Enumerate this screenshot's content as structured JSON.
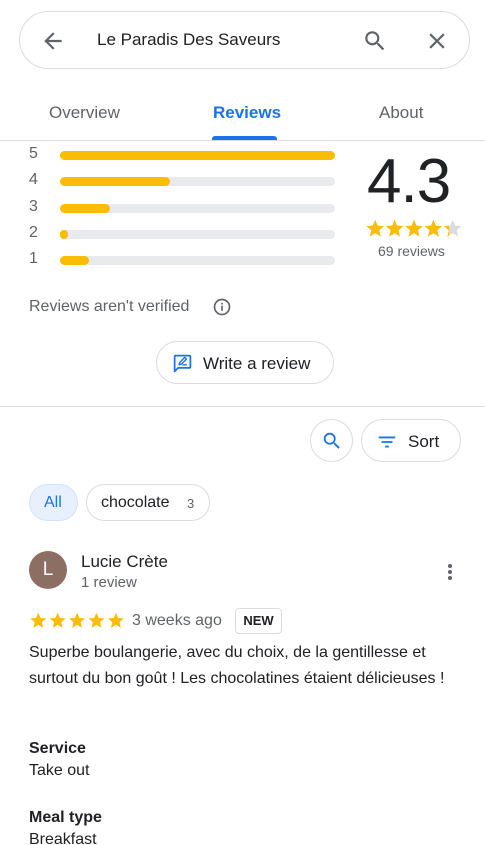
{
  "search": {
    "query": "Le Paradis Des Saveurs"
  },
  "tabs": [
    {
      "label": "Overview"
    },
    {
      "label": "Reviews"
    },
    {
      "label": "About"
    }
  ],
  "summary": {
    "rating": "4.3",
    "rating_value": 4.3,
    "review_count": "69 reviews",
    "distribution": [
      {
        "stars": "5",
        "fraction": 1.0
      },
      {
        "stars": "4",
        "fraction": 0.4
      },
      {
        "stars": "3",
        "fraction": 0.18
      },
      {
        "stars": "2",
        "fraction": 0.03
      },
      {
        "stars": "1",
        "fraction": 0.105
      }
    ],
    "bar_color": "#fbbc04",
    "star_color": "#fbbc04"
  },
  "verified_note": "Reviews aren't verified",
  "write_review": "Write a review",
  "sort_label": "Sort",
  "filters": {
    "all": "All",
    "chocolate": "chocolate",
    "chocolate_count": "3"
  },
  "review": {
    "avatar_letter": "L",
    "avatar_color": "#8d6e63",
    "author": "Lucie Crète",
    "author_reviews": "1 review",
    "rating": 5,
    "date": "3 weeks ago",
    "badge": "NEW",
    "text": "Superbe boulangerie, avec du choix, de la gentillesse et surtout du bon goût ! Les chocolatines étaient délicieuses !",
    "attributes": [
      {
        "label": "Service",
        "value": "Take out"
      },
      {
        "label": "Meal type",
        "value": "Breakfast"
      }
    ]
  },
  "colors": {
    "accent": "#1a73e8",
    "text_secondary": "#5f6368",
    "border": "#dadce0"
  }
}
